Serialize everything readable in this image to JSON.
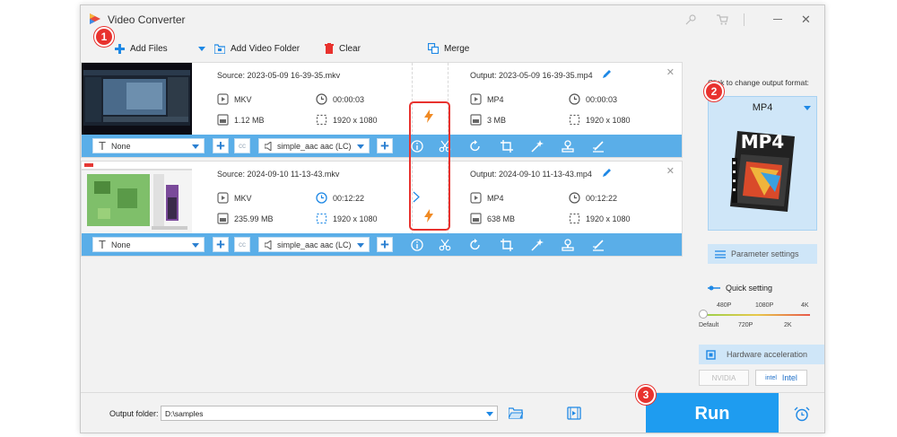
{
  "window": {
    "title": "Video Converter"
  },
  "toolbar": {
    "add_files": "Add Files",
    "add_video_folder": "Add Video Folder",
    "clear": "Clear",
    "merge": "Merge"
  },
  "files": [
    {
      "source": "Source: 2023-05-09 16-39-35.mkv",
      "src_format": "MKV",
      "src_duration": "00:00:03",
      "src_size": "1.12 MB",
      "src_resolution": "1920 x 1080",
      "output": "Output: 2023-05-09 16-39-35.mp4",
      "out_format": "MP4",
      "out_duration": "00:00:03",
      "out_size": "3 MB",
      "out_resolution": "1920 x 1080",
      "subtitle": "None",
      "audio": "simple_aac aac (LC)"
    },
    {
      "source": "Source: 2024-09-10 11-13-43.mkv",
      "src_format": "MKV",
      "src_duration": "00:12:22",
      "src_size": "235.99 MB",
      "src_resolution": "1920 x 1080",
      "output": "Output: 2024-09-10 11-13-43.mp4",
      "out_format": "MP4",
      "out_duration": "00:12:22",
      "out_size": "638 MB",
      "out_resolution": "1920 x 1080",
      "subtitle": "None",
      "audio": "simple_aac aac (LC)"
    }
  ],
  "sidebar": {
    "change_format_hint": "Click to change output format:",
    "format": "MP4",
    "format_art_text": "MP4",
    "parameter_settings": "Parameter settings",
    "quick_setting": "Quick setting",
    "quality_top": [
      "480P",
      "1080P",
      "4K"
    ],
    "quality_bottom": [
      "Default",
      "720P",
      "2K"
    ],
    "hardware_acceleration": "Hardware acceleration",
    "nvidia": "NVIDIA",
    "intel": "Intel"
  },
  "bottom": {
    "output_folder_label": "Output folder:",
    "output_folder_value": "D:\\samples",
    "run": "Run"
  },
  "steps": [
    "1",
    "2",
    "3"
  ],
  "colors": {
    "accent": "#1e9cf0",
    "bar": "#5aaee8",
    "highlight": "#e8322e",
    "flash": "#f08a24"
  }
}
